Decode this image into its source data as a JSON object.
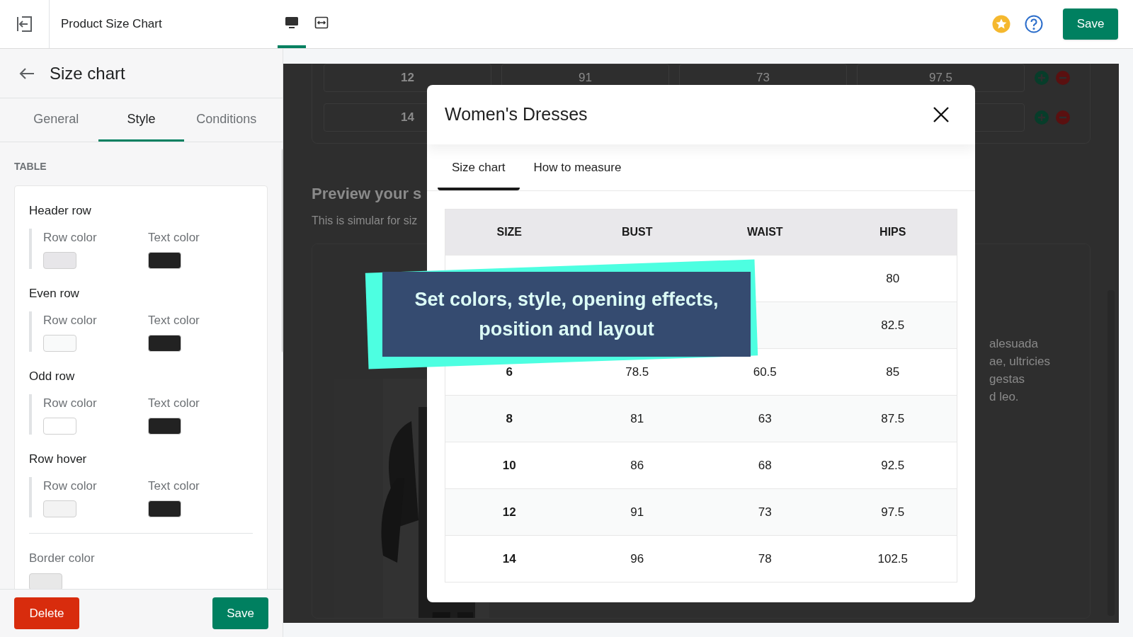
{
  "top_bar": {
    "title": "Product Size Chart",
    "view_modes": [
      {
        "kind": "desktop",
        "selected": true
      },
      {
        "kind": "fullwidth",
        "selected": false
      }
    ],
    "save_label": "Save"
  },
  "sidebar": {
    "title": "Size chart",
    "tabs": [
      {
        "label": "General",
        "selected": false
      },
      {
        "label": "Style",
        "selected": true
      },
      {
        "label": "Conditions",
        "selected": false
      }
    ],
    "section_label": "TABLE",
    "groups": [
      {
        "title": "Header row",
        "swatches": [
          {
            "label": "Row color",
            "color": "#e7e6e9"
          },
          {
            "label": "Text color",
            "color": "#222222"
          }
        ]
      },
      {
        "title": "Even row",
        "swatches": [
          {
            "label": "Row color",
            "color": "#f9fafa"
          },
          {
            "label": "Text color",
            "color": "#222222"
          }
        ]
      },
      {
        "title": "Odd row",
        "swatches": [
          {
            "label": "Row color",
            "color": "#ffffff"
          },
          {
            "label": "Text color",
            "color": "#222222"
          }
        ]
      },
      {
        "title": "Row hover",
        "swatches": [
          {
            "label": "Row color",
            "color": "#f3f3f3"
          },
          {
            "label": "Text color",
            "color": "#222222"
          }
        ]
      }
    ],
    "border": {
      "label": "Border color",
      "color": "#e8e8e8"
    },
    "delete_label": "Delete",
    "save_label": "Save"
  },
  "preview": {
    "rows": [
      {
        "cells": [
          "12",
          "91",
          "73",
          "97.5"
        ]
      },
      {
        "cells": [
          "14"
        ]
      }
    ],
    "heading": "Preview your s",
    "subtitle": "This is simular for siz",
    "text_lines": [
      "alesuada",
      "ae, ultricies",
      "gestas",
      "d leo."
    ]
  },
  "modal": {
    "title": "Women's Dresses",
    "tabs": [
      {
        "label": "Size chart",
        "selected": true
      },
      {
        "label": "How to measure",
        "selected": false
      }
    ],
    "columns": [
      "SIZE",
      "BUST",
      "WAIST",
      "HIPS"
    ],
    "rows": [
      [
        null,
        null,
        null,
        "80"
      ],
      [
        null,
        null,
        null,
        "82.5"
      ],
      [
        "6",
        "78.5",
        "60.5",
        "85"
      ],
      [
        "8",
        "81",
        "63",
        "87.5"
      ],
      [
        "10",
        "86",
        "68",
        "92.5"
      ],
      [
        "12",
        "91",
        "73",
        "97.5"
      ],
      [
        "14",
        "96",
        "78",
        "102.5"
      ]
    ]
  },
  "banner": {
    "lines": [
      "Set colors, style, opening effects,",
      "position and layout"
    ]
  }
}
